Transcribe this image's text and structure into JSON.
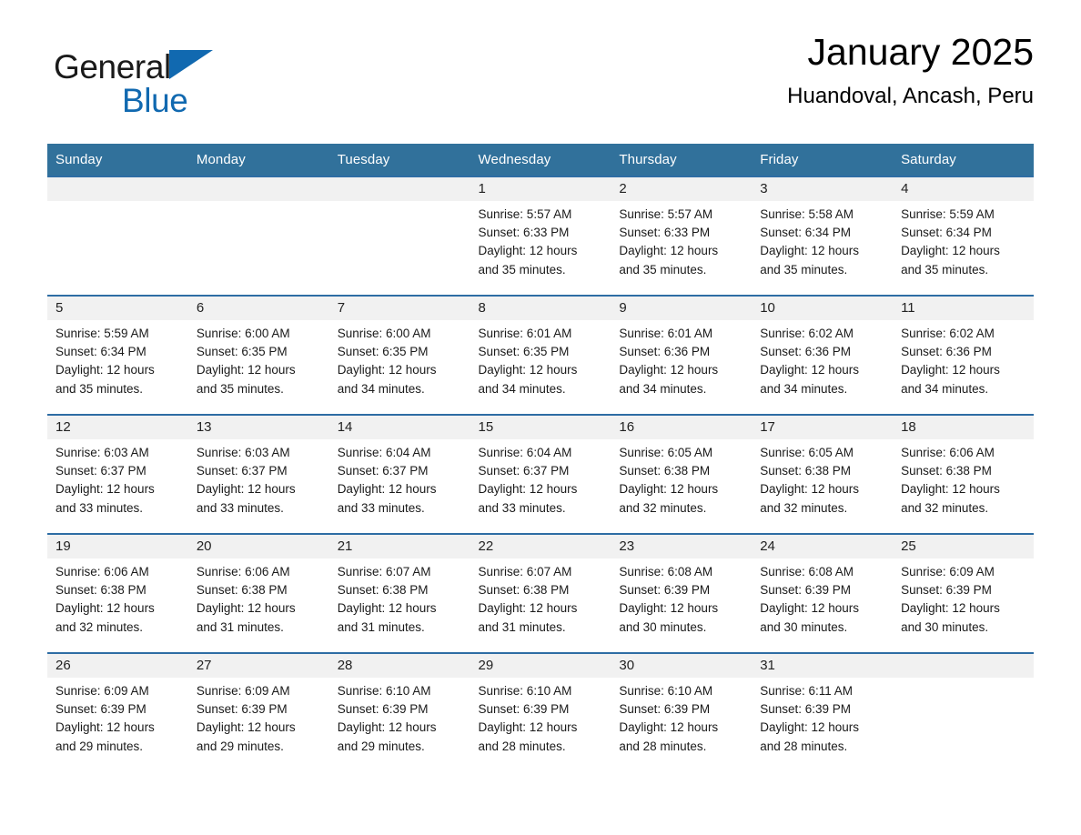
{
  "brand": {
    "name_part1": "General",
    "name_part2": "Blue",
    "triangle_color": "#1169b0",
    "text_color": "#1a1a1a"
  },
  "header": {
    "month_title": "January 2025",
    "location": "Huandoval, Ancash, Peru"
  },
  "theme": {
    "header_blue": "#31719b",
    "row_rule_blue": "#2e6da4",
    "daynum_band": "#f1f1f1"
  },
  "weekdays": [
    "Sunday",
    "Monday",
    "Tuesday",
    "Wednesday",
    "Thursday",
    "Friday",
    "Saturday"
  ],
  "weeks": [
    [
      {
        "day": "",
        "lines": []
      },
      {
        "day": "",
        "lines": []
      },
      {
        "day": "",
        "lines": []
      },
      {
        "day": "1",
        "lines": [
          "Sunrise: 5:57 AM",
          "Sunset: 6:33 PM",
          "Daylight: 12 hours",
          "and 35 minutes."
        ]
      },
      {
        "day": "2",
        "lines": [
          "Sunrise: 5:57 AM",
          "Sunset: 6:33 PM",
          "Daylight: 12 hours",
          "and 35 minutes."
        ]
      },
      {
        "day": "3",
        "lines": [
          "Sunrise: 5:58 AM",
          "Sunset: 6:34 PM",
          "Daylight: 12 hours",
          "and 35 minutes."
        ]
      },
      {
        "day": "4",
        "lines": [
          "Sunrise: 5:59 AM",
          "Sunset: 6:34 PM",
          "Daylight: 12 hours",
          "and 35 minutes."
        ]
      }
    ],
    [
      {
        "day": "5",
        "lines": [
          "Sunrise: 5:59 AM",
          "Sunset: 6:34 PM",
          "Daylight: 12 hours",
          "and 35 minutes."
        ]
      },
      {
        "day": "6",
        "lines": [
          "Sunrise: 6:00 AM",
          "Sunset: 6:35 PM",
          "Daylight: 12 hours",
          "and 35 minutes."
        ]
      },
      {
        "day": "7",
        "lines": [
          "Sunrise: 6:00 AM",
          "Sunset: 6:35 PM",
          "Daylight: 12 hours",
          "and 34 minutes."
        ]
      },
      {
        "day": "8",
        "lines": [
          "Sunrise: 6:01 AM",
          "Sunset: 6:35 PM",
          "Daylight: 12 hours",
          "and 34 minutes."
        ]
      },
      {
        "day": "9",
        "lines": [
          "Sunrise: 6:01 AM",
          "Sunset: 6:36 PM",
          "Daylight: 12 hours",
          "and 34 minutes."
        ]
      },
      {
        "day": "10",
        "lines": [
          "Sunrise: 6:02 AM",
          "Sunset: 6:36 PM",
          "Daylight: 12 hours",
          "and 34 minutes."
        ]
      },
      {
        "day": "11",
        "lines": [
          "Sunrise: 6:02 AM",
          "Sunset: 6:36 PM",
          "Daylight: 12 hours",
          "and 34 minutes."
        ]
      }
    ],
    [
      {
        "day": "12",
        "lines": [
          "Sunrise: 6:03 AM",
          "Sunset: 6:37 PM",
          "Daylight: 12 hours",
          "and 33 minutes."
        ]
      },
      {
        "day": "13",
        "lines": [
          "Sunrise: 6:03 AM",
          "Sunset: 6:37 PM",
          "Daylight: 12 hours",
          "and 33 minutes."
        ]
      },
      {
        "day": "14",
        "lines": [
          "Sunrise: 6:04 AM",
          "Sunset: 6:37 PM",
          "Daylight: 12 hours",
          "and 33 minutes."
        ]
      },
      {
        "day": "15",
        "lines": [
          "Sunrise: 6:04 AM",
          "Sunset: 6:37 PM",
          "Daylight: 12 hours",
          "and 33 minutes."
        ]
      },
      {
        "day": "16",
        "lines": [
          "Sunrise: 6:05 AM",
          "Sunset: 6:38 PM",
          "Daylight: 12 hours",
          "and 32 minutes."
        ]
      },
      {
        "day": "17",
        "lines": [
          "Sunrise: 6:05 AM",
          "Sunset: 6:38 PM",
          "Daylight: 12 hours",
          "and 32 minutes."
        ]
      },
      {
        "day": "18",
        "lines": [
          "Sunrise: 6:06 AM",
          "Sunset: 6:38 PM",
          "Daylight: 12 hours",
          "and 32 minutes."
        ]
      }
    ],
    [
      {
        "day": "19",
        "lines": [
          "Sunrise: 6:06 AM",
          "Sunset: 6:38 PM",
          "Daylight: 12 hours",
          "and 32 minutes."
        ]
      },
      {
        "day": "20",
        "lines": [
          "Sunrise: 6:06 AM",
          "Sunset: 6:38 PM",
          "Daylight: 12 hours",
          "and 31 minutes."
        ]
      },
      {
        "day": "21",
        "lines": [
          "Sunrise: 6:07 AM",
          "Sunset: 6:38 PM",
          "Daylight: 12 hours",
          "and 31 minutes."
        ]
      },
      {
        "day": "22",
        "lines": [
          "Sunrise: 6:07 AM",
          "Sunset: 6:38 PM",
          "Daylight: 12 hours",
          "and 31 minutes."
        ]
      },
      {
        "day": "23",
        "lines": [
          "Sunrise: 6:08 AM",
          "Sunset: 6:39 PM",
          "Daylight: 12 hours",
          "and 30 minutes."
        ]
      },
      {
        "day": "24",
        "lines": [
          "Sunrise: 6:08 AM",
          "Sunset: 6:39 PM",
          "Daylight: 12 hours",
          "and 30 minutes."
        ]
      },
      {
        "day": "25",
        "lines": [
          "Sunrise: 6:09 AM",
          "Sunset: 6:39 PM",
          "Daylight: 12 hours",
          "and 30 minutes."
        ]
      }
    ],
    [
      {
        "day": "26",
        "lines": [
          "Sunrise: 6:09 AM",
          "Sunset: 6:39 PM",
          "Daylight: 12 hours",
          "and 29 minutes."
        ]
      },
      {
        "day": "27",
        "lines": [
          "Sunrise: 6:09 AM",
          "Sunset: 6:39 PM",
          "Daylight: 12 hours",
          "and 29 minutes."
        ]
      },
      {
        "day": "28",
        "lines": [
          "Sunrise: 6:10 AM",
          "Sunset: 6:39 PM",
          "Daylight: 12 hours",
          "and 29 minutes."
        ]
      },
      {
        "day": "29",
        "lines": [
          "Sunrise: 6:10 AM",
          "Sunset: 6:39 PM",
          "Daylight: 12 hours",
          "and 28 minutes."
        ]
      },
      {
        "day": "30",
        "lines": [
          "Sunrise: 6:10 AM",
          "Sunset: 6:39 PM",
          "Daylight: 12 hours",
          "and 28 minutes."
        ]
      },
      {
        "day": "31",
        "lines": [
          "Sunrise: 6:11 AM",
          "Sunset: 6:39 PM",
          "Daylight: 12 hours",
          "and 28 minutes."
        ]
      },
      {
        "day": "",
        "lines": []
      }
    ]
  ]
}
